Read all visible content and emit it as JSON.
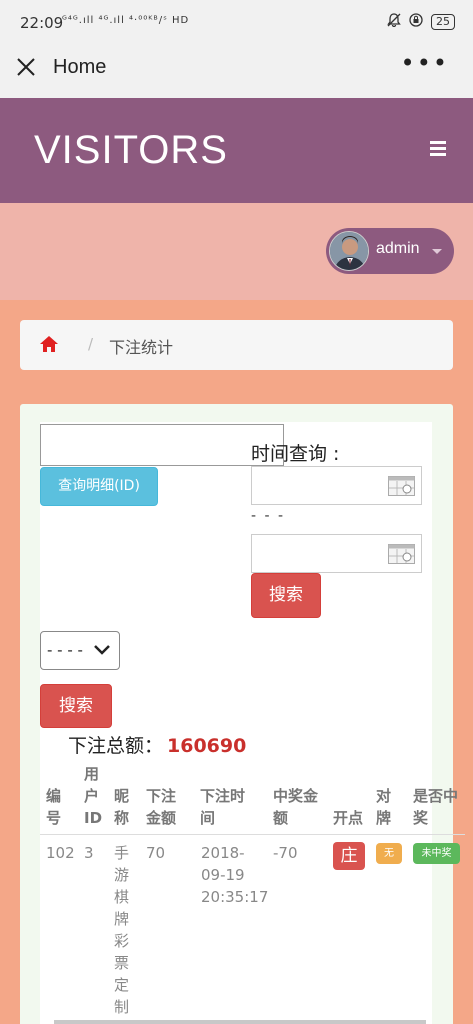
{
  "status": {
    "time": "22:09",
    "signal": "ᴳ⁴ᴳ.ıll ⁴ᴳ.ıll ⁴·⁰⁰ᴷᴮ/ˢ HD",
    "battery": "25"
  },
  "webview": {
    "title": "Home",
    "more": "•••"
  },
  "header": {
    "brand": "VISITORS"
  },
  "user": {
    "name": "admin"
  },
  "breadcrumb": {
    "sep": "/",
    "current": "下注统计"
  },
  "filters": {
    "id_value": "",
    "query_button": "查询明细(ID)",
    "time_label": "时间查询 :",
    "start_date": "",
    "dash": "- - -",
    "end_date": "",
    "search_button": "搜索",
    "select_value": "- - - -",
    "search_button2": "搜索"
  },
  "summary": {
    "label": "下注总额：",
    "amount": "160690"
  },
  "table": {
    "headers": [
      "编号",
      "用户ID",
      "昵称",
      "下注金额",
      "下注时间",
      "中奖金额",
      "开点",
      "对牌",
      "是否中奖"
    ],
    "rows": [
      {
        "id": "102",
        "user_id": "3",
        "nickname": "手游棋牌彩票定制",
        "bet_amount": "70",
        "bet_time": "2018-09-19 20:35:17",
        "win_amount": "-70",
        "open": "庄",
        "pair": "无",
        "won": "未中奖"
      }
    ]
  },
  "colors": {
    "header": "#8d5a7f",
    "danger": "#d9534f",
    "info": "#5bc0de",
    "warning": "#f0ad4e",
    "success": "#5cb85c",
    "amount": "#c9302c"
  }
}
